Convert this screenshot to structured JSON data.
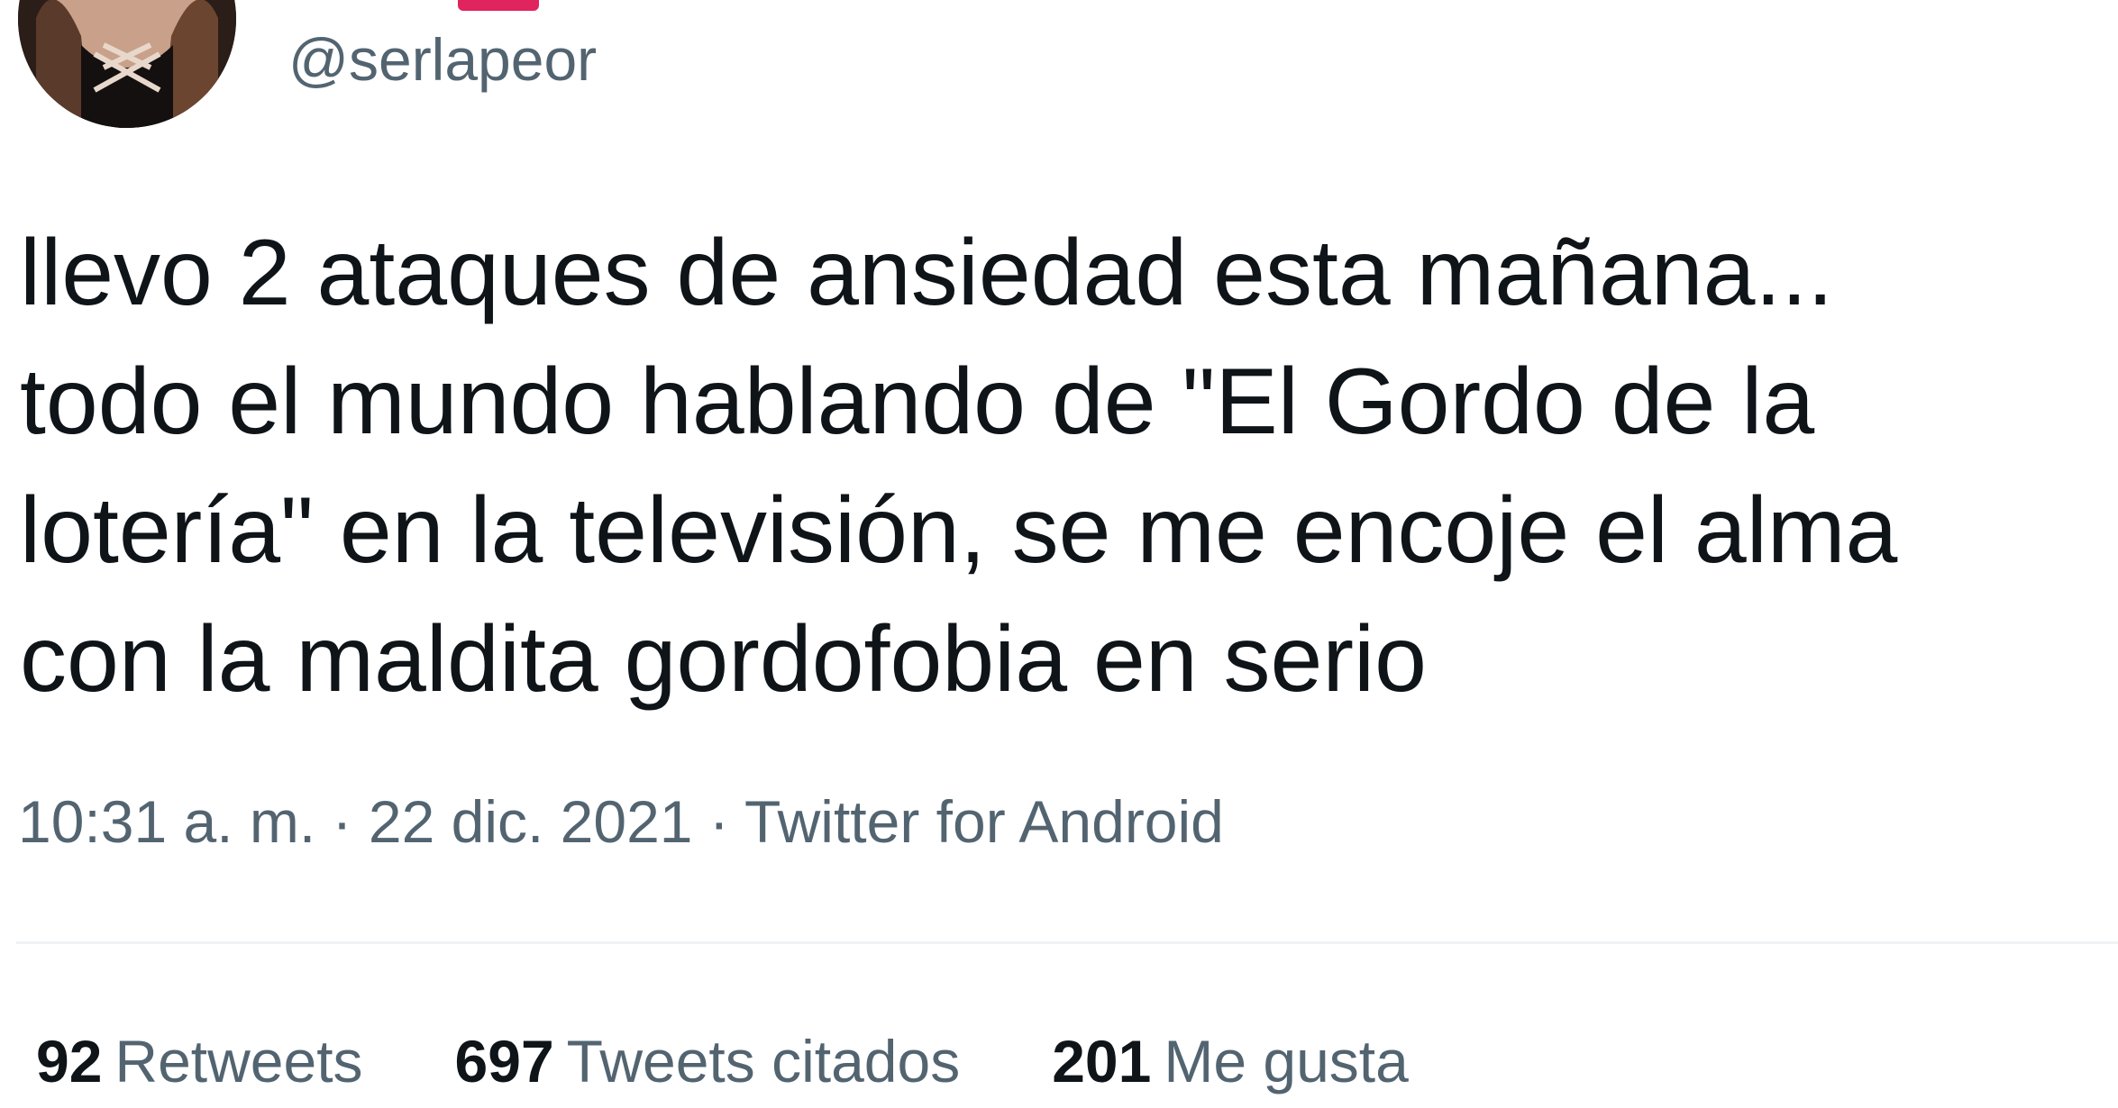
{
  "tweet": {
    "handle": "@serlapeor",
    "text_lines": [
      "llevo 2 ataques de ansiedad esta mañana...",
      "todo el mundo hablando de \"El Gordo de la",
      "lotería\" en la televisión, se me encoje el alma",
      "con la maldita gordofobia en serio"
    ],
    "time": "10:31 a. m.",
    "separator": "·",
    "date": "22 dic. 2021",
    "source": "Twitter for Android"
  },
  "stats": {
    "retweets": {
      "count": "92",
      "label": "Retweets"
    },
    "quotes": {
      "count": "697",
      "label": "Tweets citados"
    },
    "likes": {
      "count": "201",
      "label": "Me gusta"
    }
  },
  "colors": {
    "text": "#0f1419",
    "secondary": "#536471",
    "divider": "#eff3f4",
    "badge": "#e0245e"
  },
  "icons": {
    "avatar": "profile-photo"
  }
}
